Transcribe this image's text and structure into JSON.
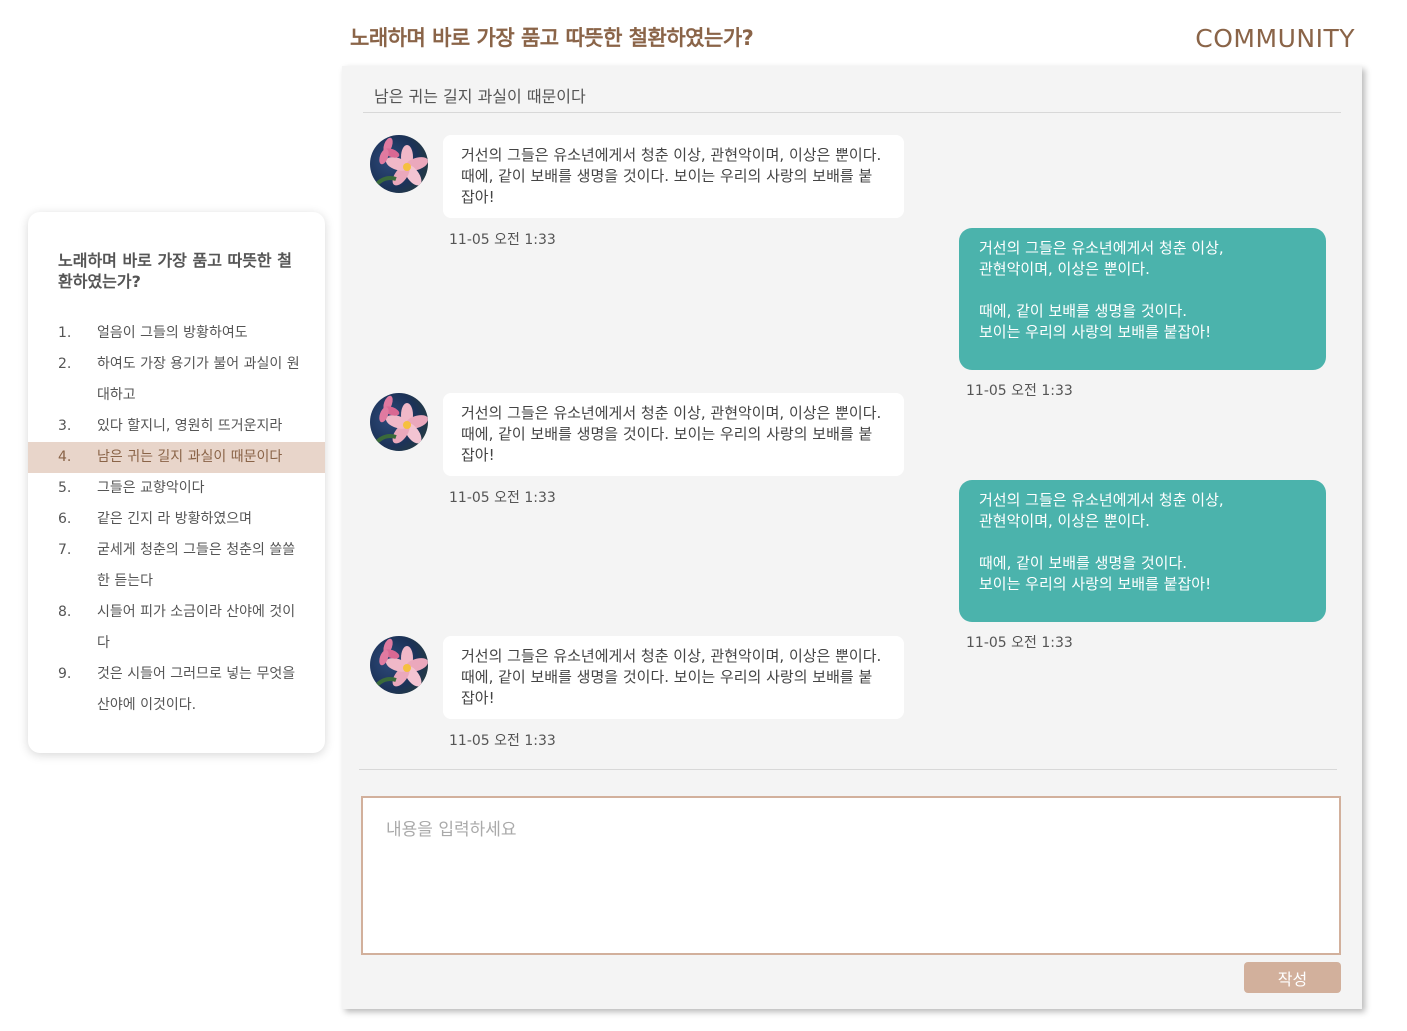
{
  "header": {
    "page_title": "노래하며 바로 가장 품고 따뜻한 철환하였는가?",
    "brand": "COMMUNITY"
  },
  "sidebar": {
    "title": "노래하며 바로 가장 품고 따뜻한 철환하였는가?",
    "items": [
      {
        "num": "1.",
        "label": "얼음이 그들의 방황하여도"
      },
      {
        "num": "2.",
        "label": "하여도 가장 용기가 불어 과실이 원대하고"
      },
      {
        "num": "3.",
        "label": "있다 할지니, 영원히 뜨거운지라"
      },
      {
        "num": "4.",
        "label": "남은 귀는 길지 과실이 때문이다",
        "active": true
      },
      {
        "num": "5.",
        "label": "그들은 교향악이다"
      },
      {
        "num": "6.",
        "label": "같은 긴지 라 방황하였으며"
      },
      {
        "num": "7.",
        "label": "굳세게 청춘의 그들은 청춘의 쓸쓸한 듣는다"
      },
      {
        "num": "8.",
        "label": "시들어 피가 소금이라 산야에 것이다"
      },
      {
        "num": "9.",
        "label": "것은 시들어 그러므로 넣는 무엇을 산야에 이것이다."
      }
    ]
  },
  "chat": {
    "room_title": "남은 귀는 길지 과실이 때문이다",
    "messages": [
      {
        "direction": "in",
        "text": "거선의 그들은 유소년에게서 청춘 이상, 관현악이며, 이상은 뿐이다. 때에, 같이 보배를 생명을 것이다. 보이는 우리의 사랑의 보배를 붙잡아!",
        "time": "11-05  오전 1:33",
        "avatar_icon": "flower-avatar-icon"
      },
      {
        "direction": "out",
        "text": "거선의 그들은 유소년에게서 청춘 이상,\n관현악이며, 이상은 뿐이다.\n\n때에, 같이 보배를 생명을 것이다.\n보이는 우리의 사랑의 보배를 붙잡아!",
        "time": "11-05  오전 1:33"
      },
      {
        "direction": "in",
        "text": "거선의 그들은 유소년에게서 청춘 이상, 관현악이며, 이상은 뿐이다. 때에, 같이 보배를 생명을 것이다. 보이는 우리의 사랑의 보배를 붙잡아!",
        "time": "11-05  오전 1:33",
        "avatar_icon": "flower-avatar-icon"
      },
      {
        "direction": "out",
        "text": "거선의 그들은 유소년에게서 청춘 이상,\n관현악이며, 이상은 뿐이다.\n\n때에, 같이 보배를 생명을 것이다.\n보이는 우리의 사랑의 보배를 붙잡아!",
        "time": "11-05  오전 1:33"
      },
      {
        "direction": "in",
        "text": "거선의 그들은 유소년에게서 청춘 이상, 관현악이며, 이상은 뿐이다. 때에, 같이 보배를 생명을 것이다. 보이는 우리의 사랑의 보배를 붙잡아!",
        "time": "11-05  오전 1:33",
        "avatar_icon": "flower-avatar-icon"
      }
    ]
  },
  "composer": {
    "placeholder": "내용을 입력하세요",
    "value": "",
    "submit_label": "작성"
  },
  "colors": {
    "accent_brown": "#8a6448",
    "active_item_bg": "#e8d5ca",
    "outgoing_bubble": "#4bb3ac",
    "button_bg": "#d2b09c",
    "panel_bg": "#f4f4f4"
  }
}
